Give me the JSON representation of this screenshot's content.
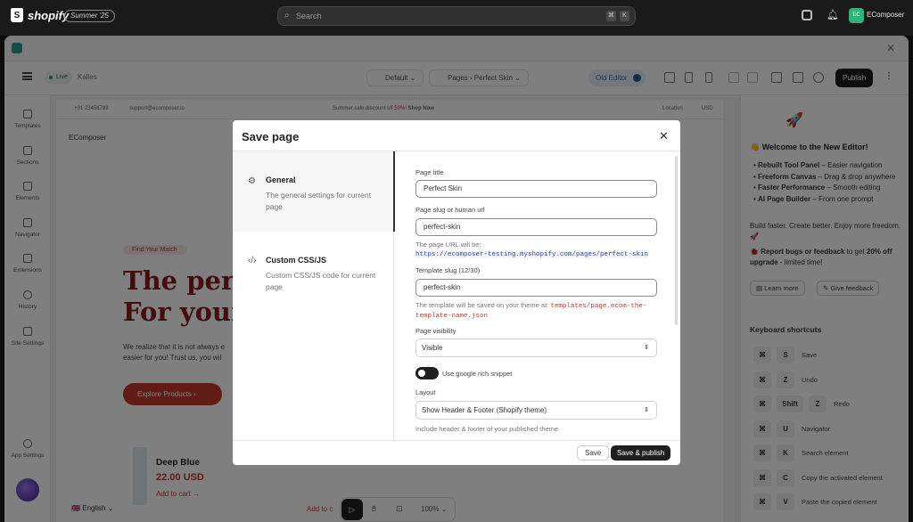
{
  "shopify_bar": {
    "logo": "shopify",
    "edition_badge": "Summer '25",
    "search_placeholder": "Search",
    "shortcut_keys": [
      "⌘",
      "K"
    ],
    "account_name": "EComposer",
    "account_initials": "EC"
  },
  "toolbar": {
    "live_label": "Live",
    "store_name": "Kalles",
    "theme_select": "Default",
    "pages_label": "Pages",
    "page_name": "Perfect Skin",
    "old_editor_label": "Old Editor",
    "publish_label": "Publish"
  },
  "left_rail": [
    {
      "label": "Templates",
      "icon": "templates-icon"
    },
    {
      "label": "Sections",
      "icon": "sections-icon"
    },
    {
      "label": "Elements",
      "icon": "elements-icon"
    },
    {
      "label": "Navigator",
      "icon": "navigator-icon"
    },
    {
      "label": "Extensions",
      "icon": "extensions-icon"
    },
    {
      "label": "History",
      "icon": "history-icon"
    },
    {
      "label": "Site Settings",
      "icon": "site-settings-icon"
    },
    {
      "label": "App Settings",
      "icon": "app-settings-icon"
    }
  ],
  "canvas": {
    "phone": "+01 23456789",
    "email": "support@ecomposer.io",
    "announcement": "Summer sale discount off",
    "announcement_pct": "50%!",
    "announcement_link": "Shop Now",
    "location": "Location",
    "currency": "USD",
    "brand": "EComposer",
    "hero_tag": "Find Your Match",
    "hero_line1": "The perfe",
    "hero_line2": "For your",
    "hero_body1": "We realize that it is not always e",
    "hero_body2": "easier for you! Trust us, you wil",
    "cta": "Explore Products",
    "product_name": "Deep Blue",
    "product_price": "22.00 USD",
    "add_to_cart": "Add to cart",
    "add_to_cart_2": "Add to c",
    "language": "English",
    "zoom": "100%"
  },
  "right_panel": {
    "welcome_title": "Welcome to the New Editor!",
    "features": [
      {
        "bold": "Rebuilt Tool Panel",
        "text": " – Easier navigation"
      },
      {
        "bold": "Freeform Canvas",
        "text": " – Drag & drop anywhere"
      },
      {
        "bold": "Faster Performance",
        "text": " – Smooth editing"
      },
      {
        "bold": "AI Page Builder",
        "text": " – From one prompt"
      }
    ],
    "tagline": "Build faster. Create better. Enjoy more freedom. 🚀",
    "report_bold": "Report bugs or feedback",
    "report_text": " to get ",
    "report_offer": "20% off upgrade",
    "report_tail": " - limited time!",
    "learn_more": "Learn more",
    "give_feedback": "Give feedback",
    "shortcuts_title": "Keyboard shortcuts",
    "shortcuts": [
      {
        "keys": [
          "⌘",
          "S"
        ],
        "label": "Save"
      },
      {
        "keys": [
          "⌘",
          "Z"
        ],
        "label": "Undo"
      },
      {
        "keys": [
          "⌘",
          "Shift",
          "Z"
        ],
        "label": "Redo"
      },
      {
        "keys": [
          "⌘",
          "U"
        ],
        "label": "Navigator"
      },
      {
        "keys": [
          "⌘",
          "K"
        ],
        "label": "Search element"
      },
      {
        "keys": [
          "⌘",
          "C"
        ],
        "label": "Copy the activated element"
      },
      {
        "keys": [
          "⌘",
          "V"
        ],
        "label": "Paste the copied element"
      }
    ]
  },
  "modal": {
    "title": "Save page",
    "tabs": [
      {
        "name": "General",
        "desc": "The general settings for current page",
        "icon": "gear-icon"
      },
      {
        "name": "Custom CSS/JS",
        "desc": "Custom CSS/JS code for current page",
        "icon": "code-icon"
      }
    ],
    "page_title_label": "Page title",
    "page_title_value": "Perfect Skin",
    "slug_label": "Page slug or human url",
    "slug_value": "perfect-skin",
    "url_note": "The page URL will be:",
    "url_value": "https://ecomposer-testing.myshopify.com/pages/perfect-skin",
    "template_slug_label": "Template slug (12/30)",
    "template_slug_value": "perfect-skin",
    "template_note": "The template will be saved on your theme at:",
    "template_path": "templates/page.ecom-the-template-name.json",
    "visibility_label": "Page visibility",
    "visibility_value": "Visible",
    "rich_snippet_label": "Use google rich snippet",
    "layout_label": "Layout",
    "layout_value": "Show Header & Footer (Shopify theme)",
    "layout_note": "Include header & footer of your published theme",
    "save_label": "Save",
    "save_publish_label": "Save & publish"
  }
}
